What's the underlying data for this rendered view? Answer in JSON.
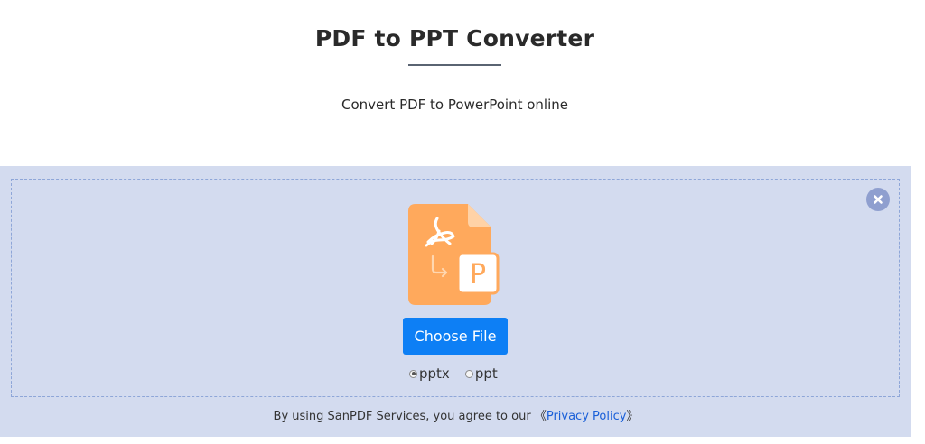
{
  "header": {
    "title": "PDF to PPT Converter",
    "subtitle": "Convert PDF to PowerPoint online"
  },
  "upload": {
    "close_icon": "close-icon",
    "file_graphic_icon": "pdf-to-ppt-icon",
    "file_letter": "P",
    "choose_label": "Choose File",
    "formats": [
      {
        "label": "pptx",
        "selected": true
      },
      {
        "label": "ppt",
        "selected": false
      }
    ]
  },
  "footer": {
    "prefix": "By using SanPDF Services, you agree to our ",
    "bracket_open": "《",
    "privacy_link": "Privacy Policy",
    "bracket_close": "》"
  },
  "colors": {
    "panel_bg": "#d3dbef",
    "dashed_border": "#8ea6d8",
    "button_primary": "#0d7ff5",
    "file_orange": "#ffa95c",
    "close_bg": "#8f9fcf",
    "link": "#1a5fd8"
  }
}
